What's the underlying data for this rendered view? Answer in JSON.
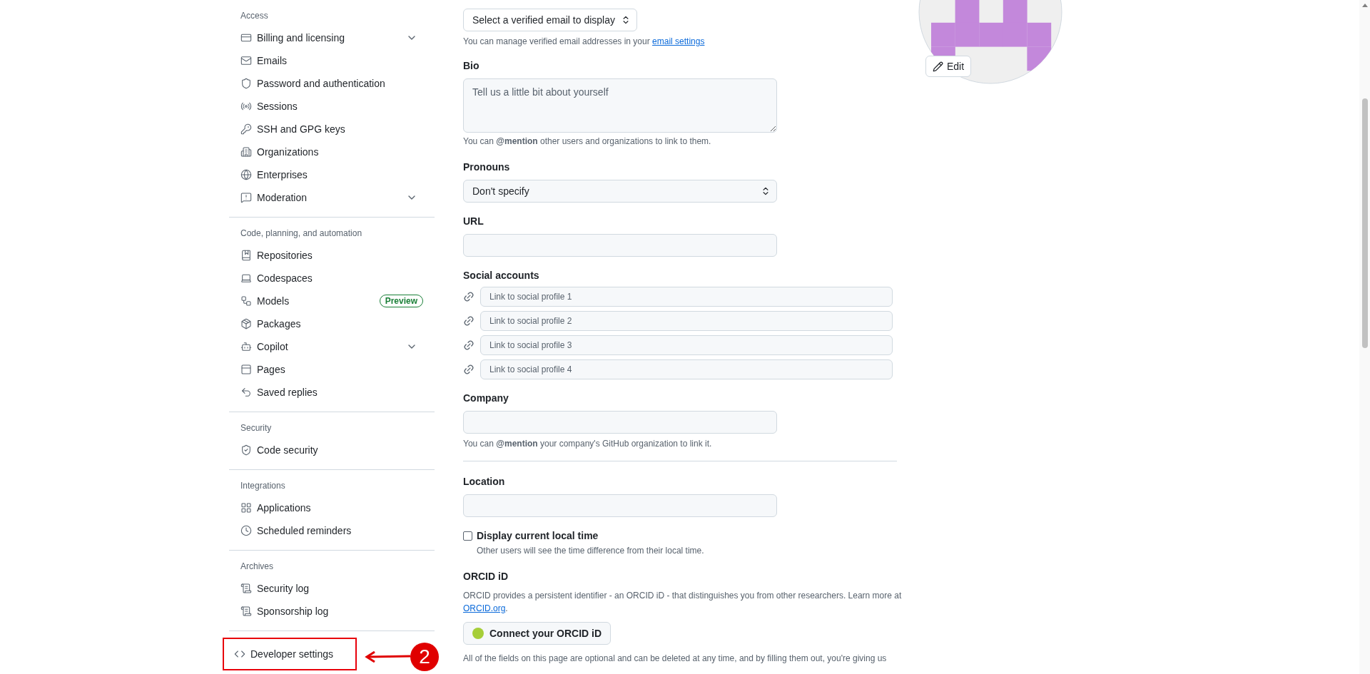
{
  "sidebar": {
    "sections": [
      {
        "heading": "Access",
        "items": [
          {
            "label": "Billing and licensing",
            "expandable": true
          },
          {
            "label": "Emails",
            "expandable": false
          },
          {
            "label": "Password and authentication",
            "expandable": false
          },
          {
            "label": "Sessions",
            "expandable": false
          },
          {
            "label": "SSH and GPG keys",
            "expandable": false
          },
          {
            "label": "Organizations",
            "expandable": false
          },
          {
            "label": "Enterprises",
            "expandable": false
          },
          {
            "label": "Moderation",
            "expandable": true
          }
        ]
      },
      {
        "heading": "Code, planning, and automation",
        "items": [
          {
            "label": "Repositories",
            "expandable": false
          },
          {
            "label": "Codespaces",
            "expandable": false
          },
          {
            "label": "Models",
            "expandable": false,
            "badge": "Preview"
          },
          {
            "label": "Packages",
            "expandable": false
          },
          {
            "label": "Copilot",
            "expandable": true
          },
          {
            "label": "Pages",
            "expandable": false
          },
          {
            "label": "Saved replies",
            "expandable": false
          }
        ]
      },
      {
        "heading": "Security",
        "items": [
          {
            "label": "Code security",
            "expandable": false
          }
        ]
      },
      {
        "heading": "Integrations",
        "items": [
          {
            "label": "Applications",
            "expandable": false
          },
          {
            "label": "Scheduled reminders",
            "expandable": false
          }
        ]
      },
      {
        "heading": "Archives",
        "items": [
          {
            "label": "Security log",
            "expandable": false
          },
          {
            "label": "Sponsorship log",
            "expandable": false
          }
        ]
      },
      {
        "items": [
          {
            "label": "Developer settings",
            "expandable": false,
            "highlighted": true
          }
        ]
      }
    ]
  },
  "callout": {
    "number": "2"
  },
  "form": {
    "public_email": {
      "value": "Select a verified email to display",
      "hint": "You can manage verified email addresses in your ",
      "hint_link": "email settings"
    },
    "bio": {
      "label": "Bio",
      "placeholder": "Tell us a little bit about yourself",
      "hint": "You can **@mention** other users and organizations to link to them."
    },
    "pronouns": {
      "label": "Pronouns",
      "value": "Don't specify"
    },
    "url": {
      "label": "URL"
    },
    "social_accounts": {
      "label": "Social accounts",
      "links": [
        {
          "placeholder": "Link to social profile 1"
        },
        {
          "placeholder": "Link to social profile 2"
        },
        {
          "placeholder": "Link to social profile 3"
        },
        {
          "placeholder": "Link to social profile 4"
        }
      ]
    },
    "company": {
      "label": "Company",
      "hint": "You can **@mention** your company's GitHub organization to link it."
    },
    "location": {
      "label": "Location"
    },
    "local_time": {
      "label": "Display current local time",
      "checked": false,
      "hint": "Other users will see the time difference from their local time."
    },
    "orcid": {
      "label": "ORCID iD",
      "text": "ORCID provides a persistent identifier - an ORCID iD - that distinguishes you from other researchers. Learn more at ",
      "link": "ORCID.org",
      "after": ".",
      "button": "Connect your ORCID iD"
    },
    "footer": {
      "text": "All of the fields on this page are optional and can be deleted at any time, and by filling them out, you're giving us"
    }
  },
  "avatar": {
    "edit_button": "Edit"
  }
}
